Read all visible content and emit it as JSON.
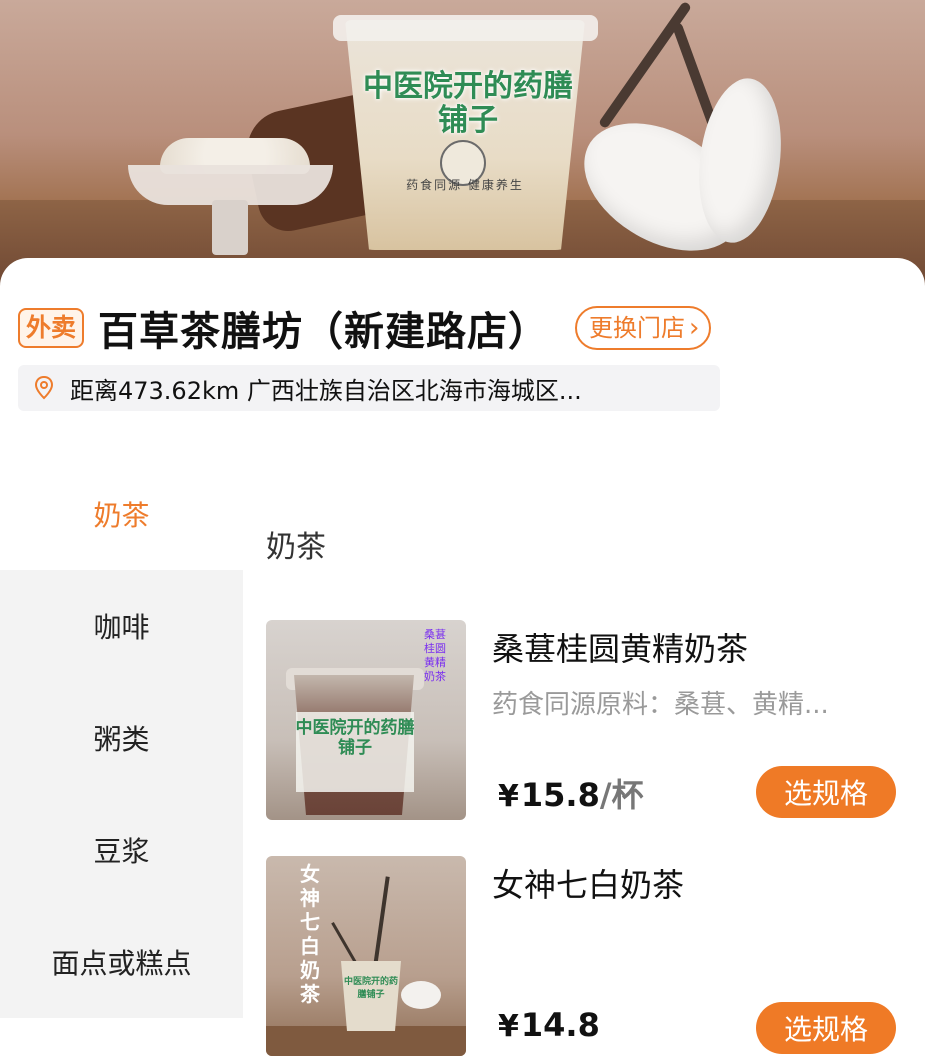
{
  "hero": {
    "cup_label": "中医院开的药膳铺子",
    "cup_slogan": "药食同源 健康养生"
  },
  "store": {
    "tag": "外卖",
    "name": "百草茶膳坊（新建路店）",
    "change_label": "更换门店",
    "address": "距离473.62km 广西壮族自治区北海市海城区..."
  },
  "sidebar": {
    "items": [
      {
        "label": "奶茶",
        "active": true
      },
      {
        "label": "咖啡",
        "active": false
      },
      {
        "label": "粥类",
        "active": false
      },
      {
        "label": "豆浆",
        "active": false
      },
      {
        "label": "面点或糕点",
        "active": false
      }
    ]
  },
  "main": {
    "section_title": "奶茶",
    "products": [
      {
        "name": "桑葚桂圆黄精奶茶",
        "desc": "药食同源原料：桑葚、黄精...",
        "currency": "¥",
        "price": "15.8",
        "unit": "/杯",
        "button": "选规格",
        "thumb_label": "中医院开的药膳铺子",
        "thumb_side": "桑葚桂圆黄精奶茶"
      },
      {
        "name": "女神七白奶茶",
        "desc": "",
        "currency": "¥",
        "price": "14.8",
        "unit": "",
        "button": "选规格",
        "thumb_label": "女神七白奶茶",
        "thumb_side": "中医院开的药膳铺子"
      }
    ]
  },
  "colors": {
    "accent": "#ee7c2c",
    "button_bg": "#ef7a26",
    "sidebar_bg": "#f3f3f3",
    "cup_text": "#2f8c55"
  }
}
